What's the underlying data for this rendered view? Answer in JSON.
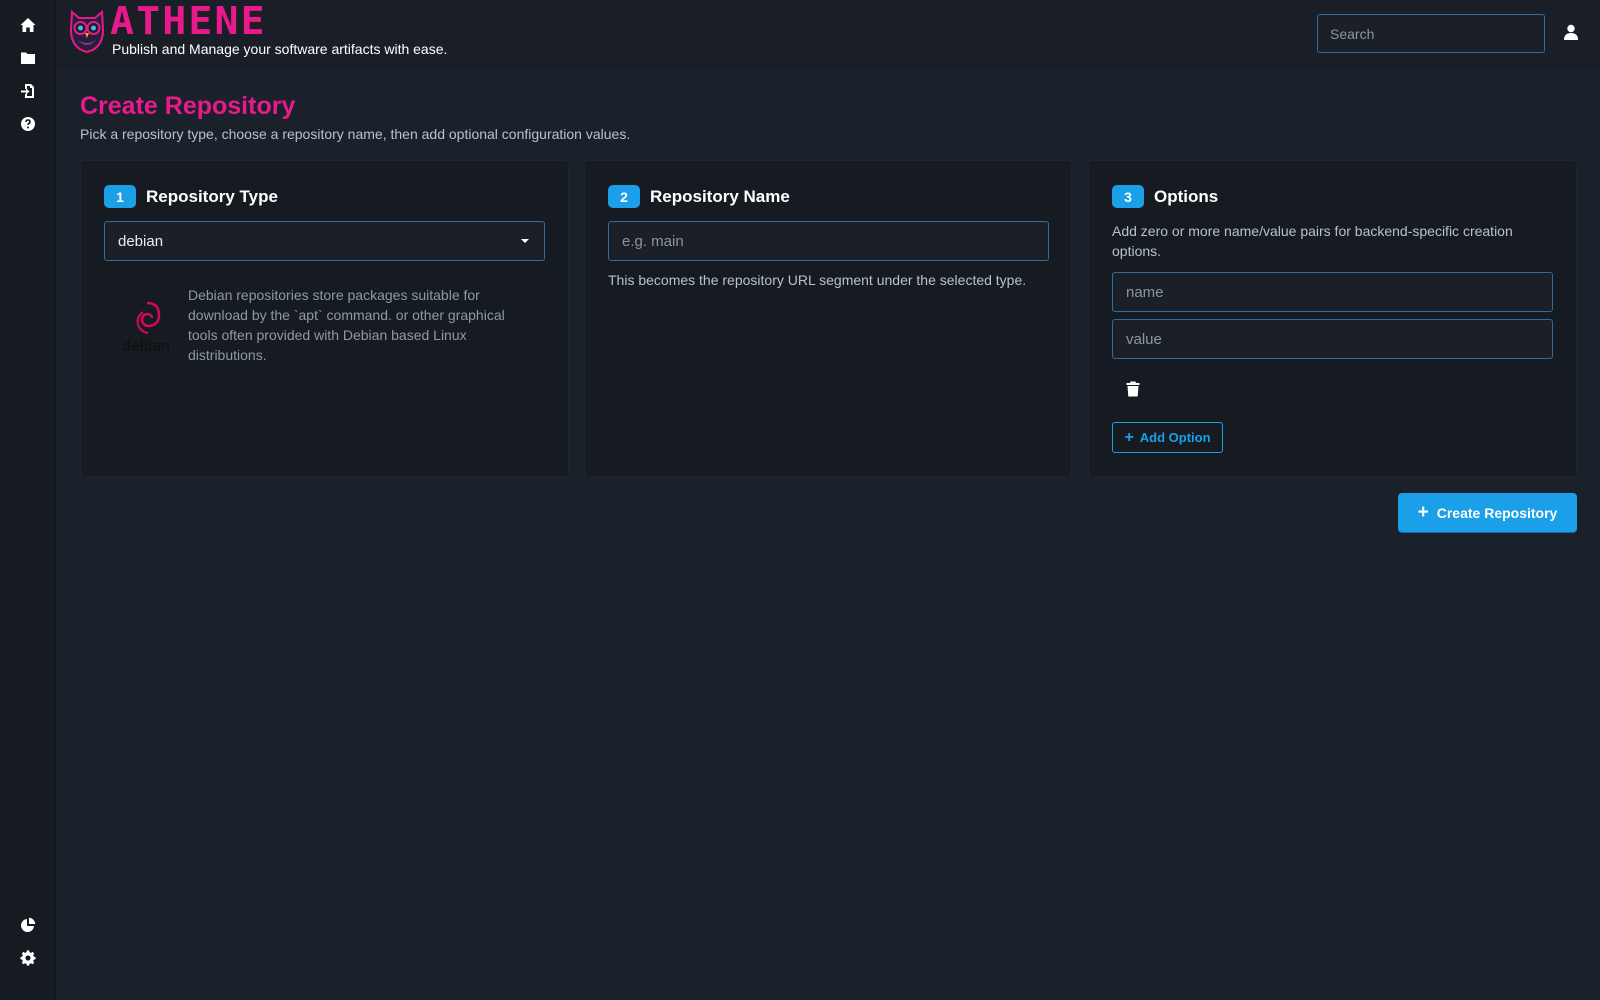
{
  "app": {
    "brand": "Athene",
    "tagline": "Publish and Manage your software artifacts with ease.",
    "brand_color": "#e8198b",
    "accent_color": "#1a9fe8"
  },
  "sidebar": {
    "top_items": [
      {
        "icon": "home-icon"
      },
      {
        "icon": "folder-icon"
      },
      {
        "icon": "file-import-icon"
      },
      {
        "icon": "help-icon"
      }
    ],
    "bottom_items": [
      {
        "icon": "pie-chart-icon"
      },
      {
        "icon": "gear-icon"
      }
    ]
  },
  "header": {
    "search_placeholder": "Search",
    "user_icon": "user-icon"
  },
  "page": {
    "title": "Create Repository",
    "subtitle": "Pick a repository type, choose a repository name, then add optional configuration values."
  },
  "cards": {
    "type": {
      "step": "1",
      "title": "Repository Type",
      "selected": "debian",
      "description": "Debian repositories store packages suitable for download by the `apt` command. or other graphical tools often provided with Debian based Linux distributions.",
      "logo_label": "debian"
    },
    "name": {
      "step": "2",
      "title": "Repository Name",
      "placeholder": "e.g. main",
      "help": "This becomes the repository URL segment under the selected type."
    },
    "options": {
      "step": "3",
      "title": "Options",
      "description": "Add zero or more name/value pairs for backend-specific creation options.",
      "name_placeholder": "name",
      "value_placeholder": "value",
      "add_label": "Add Option"
    }
  },
  "actions": {
    "create_label": "Create Repository"
  }
}
